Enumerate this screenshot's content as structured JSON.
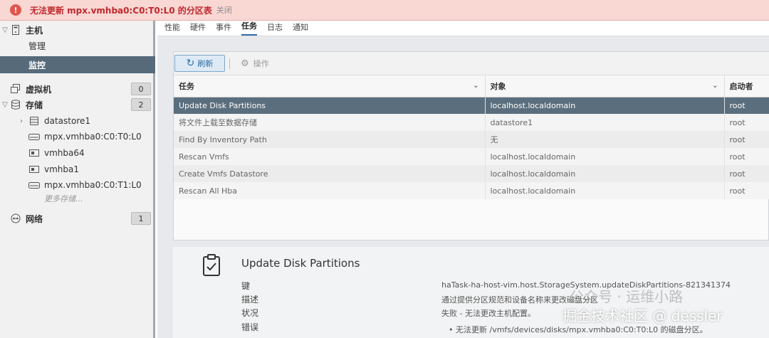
{
  "banner": {
    "message": "无法更新 mpx.vmhba0:C0:T0:L0 的分区表",
    "close_label": "关闭"
  },
  "sidebar": {
    "host": {
      "label": "主机"
    },
    "manage": {
      "label": "管理"
    },
    "monitor": {
      "label": "监控"
    },
    "vms": {
      "label": "虚拟机",
      "count": "0"
    },
    "storage": {
      "label": "存储",
      "count": "2"
    },
    "storage_items": [
      {
        "label": "datastore1"
      },
      {
        "label": "mpx.vmhba0:C0:T0:L0"
      },
      {
        "label": "vmhba64"
      },
      {
        "label": "vmhba1"
      },
      {
        "label": "mpx.vmhba0:C0:T1:L0"
      }
    ],
    "more_storage": "更多存储...",
    "network": {
      "label": "网络",
      "count": "1"
    }
  },
  "tabs": [
    "性能",
    "硬件",
    "事件",
    "任务",
    "日志",
    "通知"
  ],
  "toolbar": {
    "refresh_label": "刷新",
    "actions_label": "操作"
  },
  "table": {
    "columns": [
      "任务",
      "对象",
      "启动者"
    ],
    "rows": [
      {
        "task": "Update Disk Partitions",
        "target": "localhost.localdomain",
        "initiator": "root"
      },
      {
        "task": "将文件上载至数据存储",
        "target": "datastore1",
        "initiator": "root"
      },
      {
        "task": "Find By Inventory Path",
        "target": "无",
        "initiator": "root"
      },
      {
        "task": "Rescan Vmfs",
        "target": "localhost.localdomain",
        "initiator": "root"
      },
      {
        "task": "Create Vmfs Datastore",
        "target": "localhost.localdomain",
        "initiator": "root"
      },
      {
        "task": "Rescan All Hba",
        "target": "localhost.localdomain",
        "initiator": "root"
      }
    ]
  },
  "detail": {
    "title": "Update Disk Partitions",
    "keys": [
      "键",
      "描述",
      "状况",
      "错误"
    ],
    "values": [
      "haTask-ha-host-vim.host.StorageSystem.updateDiskPartitions-821341374",
      "通过提供分区规范和设备名称来更改磁盘分区",
      "失败 - 无法更改主机配置。"
    ],
    "error_item": "无法更新 /vmfs/devices/disks/mpx.vmhba0:C0:T0:L0 的磁盘分区。"
  },
  "watermark": {
    "line1": "公众号 · 运维小路",
    "line2": "掘金技术社区 @ dessler"
  }
}
